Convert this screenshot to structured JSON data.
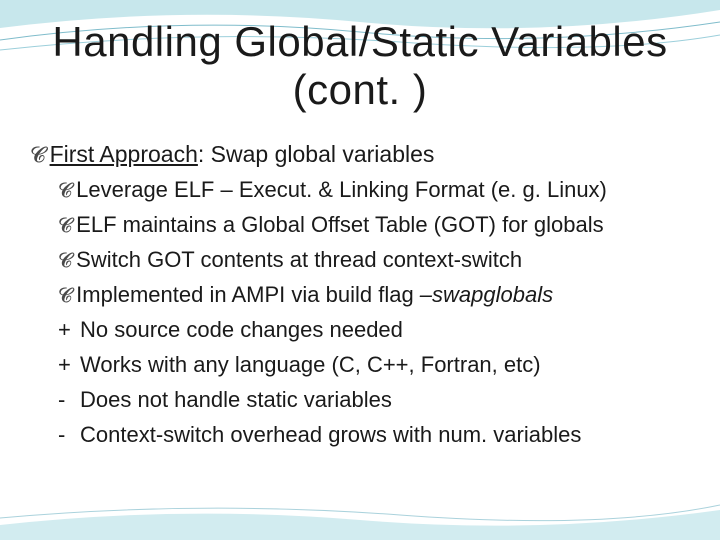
{
  "title_line1": "Handling Global/Static Variables",
  "title_line2": "(cont. )",
  "heading": {
    "prefix": "First Approach",
    "suffix": ": Swap global variables"
  },
  "sub_items": [
    "Leverage ELF – Execut. & Linking Format (e. g. Linux)",
    "ELF maintains a Global Offset Table (GOT) for globals",
    "Switch GOT contents at thread context-switch"
  ],
  "impl_item": {
    "before": "Implemented in AMPI via build flag  ",
    "flag": "–swapglobals"
  },
  "pros": [
    "No source code changes needed",
    "Works with any language (C, C++, Fortran, etc)"
  ],
  "cons": [
    "Does not handle static variables",
    "Context-switch overhead grows with num. variables"
  ],
  "marks": {
    "plus": "+",
    "minus": "-"
  }
}
